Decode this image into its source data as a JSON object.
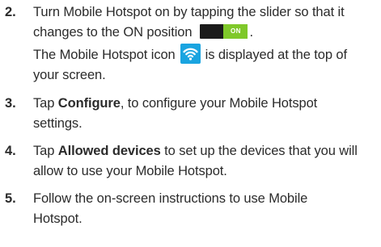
{
  "steps": [
    {
      "number": "2.",
      "line1": "Turn Mobile Hotspot on by tapping the slider so that it",
      "line2": "changes to the ON position",
      "line2_end": ".",
      "toggle_label": "ON",
      "line3_start": "The Mobile Hotspot icon",
      "line3_end": "is displayed at the top of",
      "line4": "your screen."
    },
    {
      "number": "3.",
      "tap": "Tap ",
      "bold": "Configure",
      "rest1": ", to configure your Mobile Hotspot",
      "line2": "settings."
    },
    {
      "number": "4.",
      "tap": "Tap ",
      "bold": "Allowed devices",
      "rest1": " to set up the devices that you will",
      "line2": "allow to use your Mobile Hotspot."
    },
    {
      "number": "5.",
      "line1": "Follow the on-screen instructions to use Mobile",
      "line2": "Hotspot."
    }
  ],
  "colors": {
    "toggle_on": "#7fc82a",
    "toggle_track": "#1b1b1b",
    "hotspot_icon_bg": "#1aa4e0",
    "text": "#2b2b2b"
  },
  "icons": {
    "toggle": "on-toggle-icon",
    "hotspot": "wifi-hotspot-icon"
  }
}
